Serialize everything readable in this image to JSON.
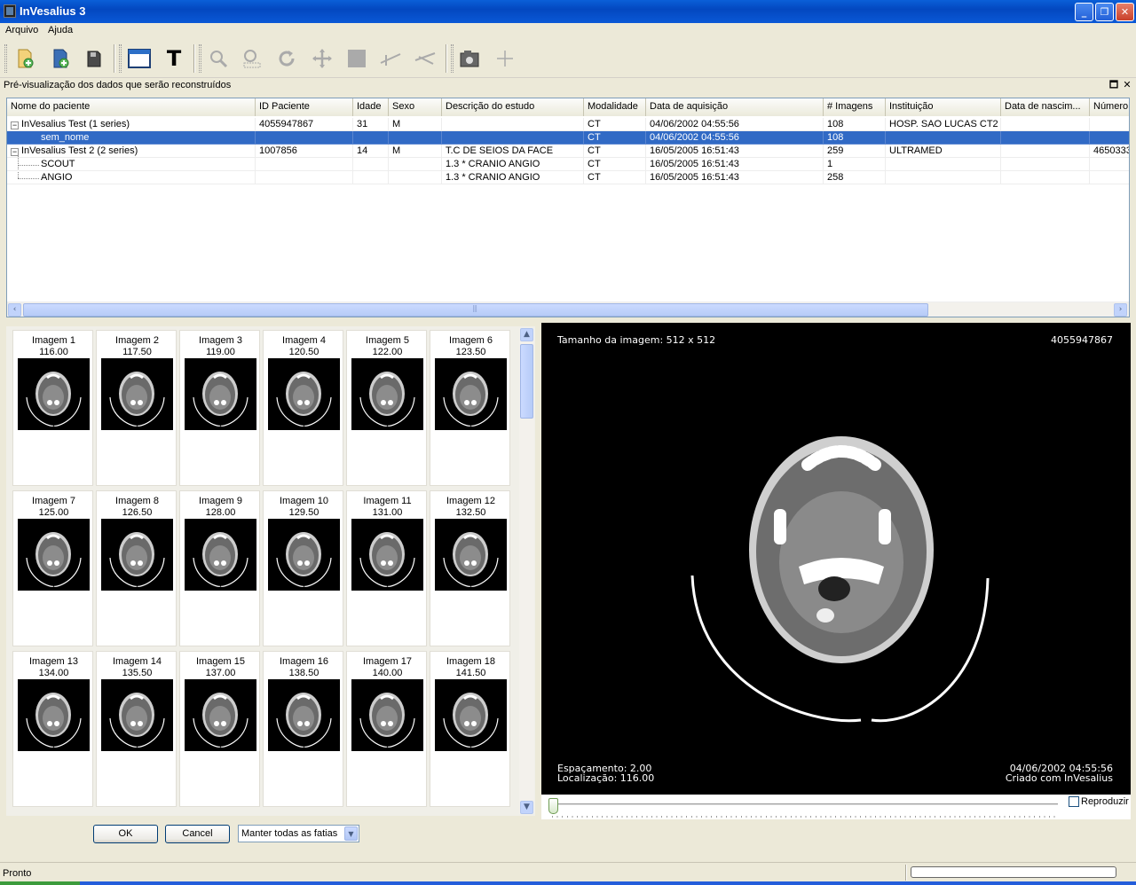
{
  "window": {
    "title": "InVesalius 3",
    "controls": [
      "_",
      "❐",
      "✕"
    ]
  },
  "menu": [
    "Arquivo",
    "Ajuda"
  ],
  "toolbar": {
    "icons": [
      "open-project-icon",
      "import-icon",
      "save-icon",
      "layout-icon",
      "text-icon",
      "zoom-icon",
      "zoom-select-icon",
      "rotate-icon",
      "pan-icon",
      "window-level-icon",
      "measure-linear-icon",
      "measure-angle-icon",
      "screenshot-icon",
      "add-icon"
    ],
    "text_tool": "T"
  },
  "panel": {
    "caption": "Pré-visualização dos dados que serão reconstruídos",
    "restore": "🗖",
    "close": "✕"
  },
  "grid": {
    "columns": [
      "Nome do paciente",
      "ID Paciente",
      "Idade",
      "Sexo",
      "Descrição do estudo",
      "Modalidade",
      "Data de aquisição",
      "# Imagens",
      "Instituição",
      "Data de nascim...",
      "Número"
    ],
    "rows": [
      {
        "level": 0,
        "expanded": true,
        "selected": false,
        "cells": [
          "InVesalius Test (1 series)",
          "4055947867",
          "31",
          "M",
          "",
          "CT",
          "04/06/2002 04:55:56",
          "108",
          "HOSP. SAO LUCAS CT2",
          "",
          ""
        ]
      },
      {
        "level": 1,
        "expanded": false,
        "selected": true,
        "cells": [
          "sem_nome",
          "",
          "",
          "",
          "",
          "CT",
          "04/06/2002 04:55:56",
          "108",
          "",
          "",
          ""
        ]
      },
      {
        "level": 0,
        "expanded": true,
        "selected": false,
        "cells": [
          "InVesalius Test 2 (2 series)",
          "1007856",
          "14",
          "M",
          "T.C DE SEIOS DA FACE",
          "CT",
          "16/05/2005 16:51:43",
          "259",
          "ULTRAMED",
          "",
          "4650333"
        ]
      },
      {
        "level": 1,
        "expanded": false,
        "selected": false,
        "cells": [
          "SCOUT",
          "",
          "",
          "",
          "1.3 * CRANIO  ANGIO",
          "CT",
          "16/05/2005 16:51:43",
          "1",
          "",
          "",
          ""
        ]
      },
      {
        "level": 1,
        "expanded": false,
        "selected": false,
        "cells": [
          "ANGIO",
          "",
          "",
          "",
          "1.3 * CRANIO  ANGIO",
          "CT",
          "16/05/2005 16:51:43",
          "258",
          "",
          "",
          ""
        ]
      }
    ],
    "scroll_left": "‹",
    "scroll_right": "›"
  },
  "thumbnails": [
    {
      "label": "Imagem 1",
      "value": "116.00"
    },
    {
      "label": "Imagem 2",
      "value": "117.50"
    },
    {
      "label": "Imagem 3",
      "value": "119.00"
    },
    {
      "label": "Imagem 4",
      "value": "120.50"
    },
    {
      "label": "Imagem 5",
      "value": "122.00"
    },
    {
      "label": "Imagem 6",
      "value": "123.50"
    },
    {
      "label": "Imagem 7",
      "value": "125.00"
    },
    {
      "label": "Imagem 8",
      "value": "126.50"
    },
    {
      "label": "Imagem 9",
      "value": "128.00"
    },
    {
      "label": "Imagem 10",
      "value": "129.50"
    },
    {
      "label": "Imagem 11",
      "value": "131.00"
    },
    {
      "label": "Imagem 12",
      "value": "132.50"
    },
    {
      "label": "Imagem 13",
      "value": "134.00"
    },
    {
      "label": "Imagem 14",
      "value": "135.50"
    },
    {
      "label": "Imagem 15",
      "value": "137.00"
    },
    {
      "label": "Imagem 16",
      "value": "138.50"
    },
    {
      "label": "Imagem 17",
      "value": "140.00"
    },
    {
      "label": "Imagem 18",
      "value": "141.50"
    }
  ],
  "preview": {
    "image_size": "Tamanho da imagem: 512 x 512",
    "patient_id": "4055947867",
    "spacing": "Espaçamento: 2.00",
    "location": "Localização: 116.00",
    "date": "04/06/2002 04:55:56",
    "created_with": "Criado com InVesalius",
    "play_label": "Reproduzir",
    "play_checked": false,
    "slice_position": 0
  },
  "actions": {
    "ok": "OK",
    "cancel": "Cancel",
    "slice_option": "Manter todas as fatias"
  },
  "status": {
    "text": "Pronto"
  },
  "colors": {
    "selection": "#316ac5",
    "titlebar": "#0348c0",
    "window_bg": "#ece9d8"
  }
}
